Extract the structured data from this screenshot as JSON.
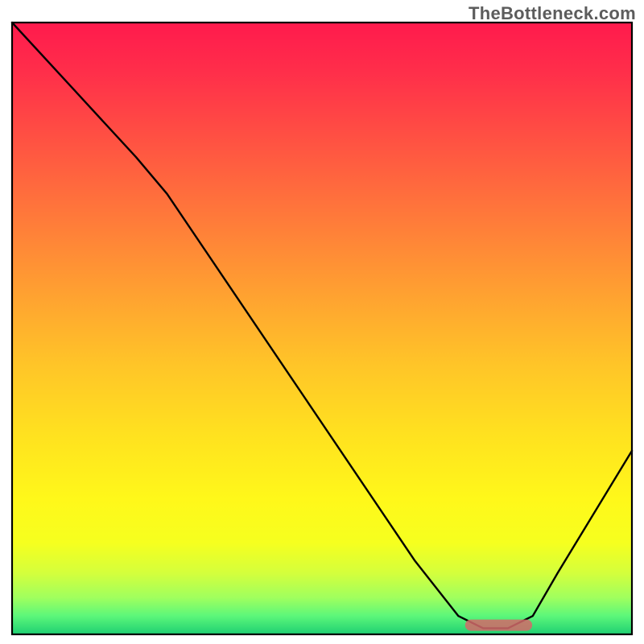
{
  "watermark": "TheBottleneck.com",
  "colors": {
    "curve": "#000000",
    "band": "#d46a6a",
    "gradient_top": "#ff1a4d",
    "gradient_bottom": "#1ecf72"
  },
  "chart_data": {
    "type": "line",
    "title": "",
    "xlabel": "",
    "ylabel": "",
    "xlim": [
      0,
      100
    ],
    "ylim": [
      0,
      100
    ],
    "series": [
      {
        "name": "bottleneck_curve",
        "x": [
          0,
          10,
          20,
          25,
          35,
          45,
          55,
          65,
          72,
          76,
          80,
          84,
          88,
          100
        ],
        "y": [
          100,
          89,
          78,
          72,
          57,
          42,
          27,
          12,
          3,
          1,
          1,
          3,
          10,
          30
        ]
      }
    ],
    "optimal_band": {
      "x_start": 74,
      "x_end": 83,
      "y": 1.5
    }
  }
}
